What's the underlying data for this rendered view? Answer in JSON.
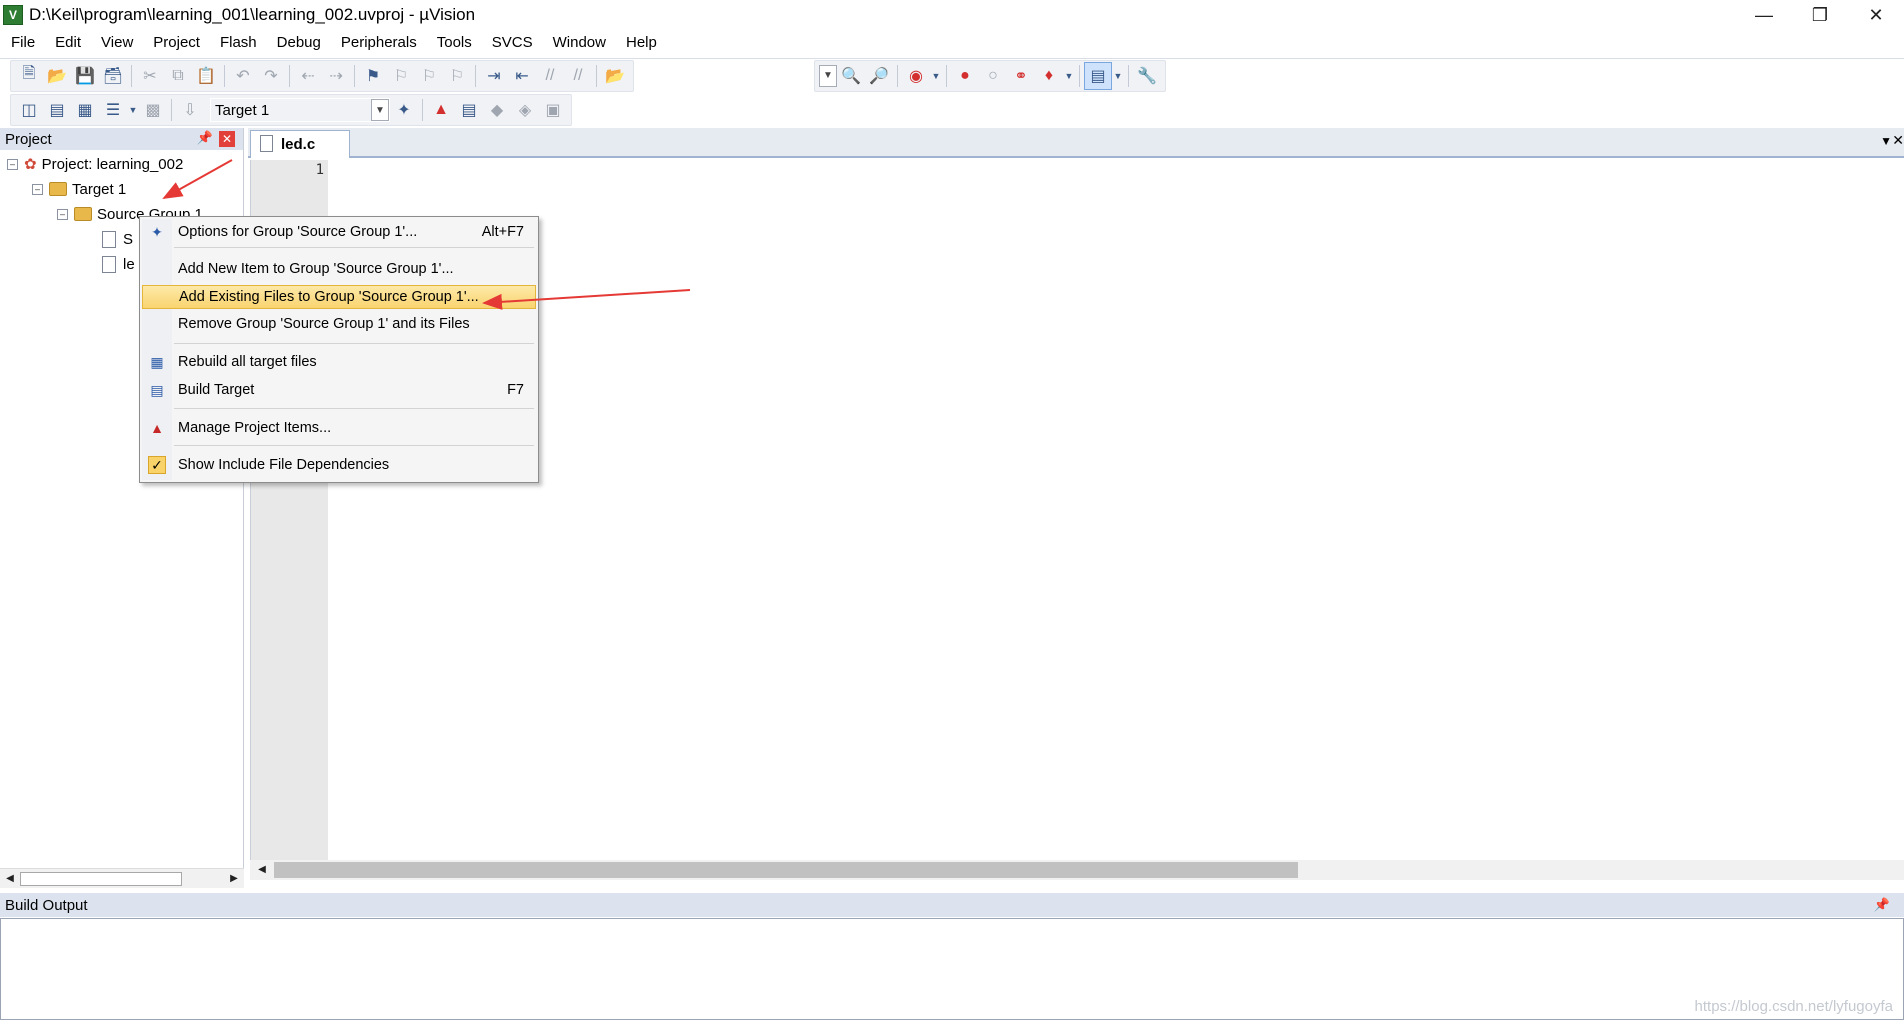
{
  "window": {
    "title": "D:\\Keil\\program\\learning_001\\learning_002.uvproj - µVision",
    "app_icon": "µVision-app-icon",
    "controls": [
      "minimize",
      "restore",
      "close"
    ]
  },
  "menu": [
    "File",
    "Edit",
    "View",
    "Project",
    "Flash",
    "Debug",
    "Peripherals",
    "Tools",
    "SVCS",
    "Window",
    "Help"
  ],
  "toolbar": {
    "target_combo": "Target 1"
  },
  "project_panel": {
    "title": "Project",
    "tree": {
      "project": "Project: learning_002",
      "target": "Target 1",
      "group": "Source Group 1",
      "file1": "S",
      "file2": "le"
    }
  },
  "editor": {
    "tab": "led.c",
    "line_number": "1"
  },
  "context_menu": {
    "items": [
      {
        "label": "Options for Group 'Source Group 1'...",
        "shortcut": "Alt+F7",
        "icon": "options-wand-icon"
      },
      {
        "label": "Add New  Item to Group 'Source Group 1'...",
        "shortcut": ""
      },
      {
        "label": "Add Existing Files to Group 'Source Group 1'...",
        "shortcut": "",
        "highlighted": true
      },
      {
        "label": "Remove Group 'Source Group 1' and its Files",
        "shortcut": ""
      },
      {
        "label": "Rebuild all target files",
        "shortcut": "",
        "icon": "rebuild-icon"
      },
      {
        "label": "Build Target",
        "shortcut": "F7",
        "icon": "build-icon"
      },
      {
        "label": "Manage Project Items...",
        "shortcut": "",
        "icon": "manage-items-icon"
      },
      {
        "label": "Show Include File Dependencies",
        "shortcut": "",
        "icon": "checkmark-icon",
        "checked": true
      }
    ]
  },
  "build_output": {
    "title": "Build Output"
  },
  "watermark": "https://blog.csdn.net/lyfugoyfa",
  "colors": {
    "highlight": "#f9d470",
    "panel_header": "#dce3ee",
    "annotation_arrow": "#e53935"
  }
}
